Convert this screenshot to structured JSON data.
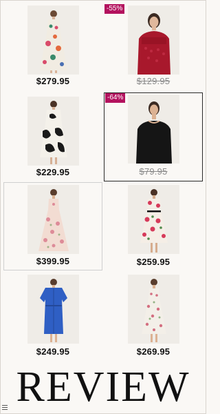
{
  "products": [
    {
      "price": "$279.95",
      "badge": null,
      "price_style": "regular",
      "dress": "floral-maxi-multicolor"
    },
    {
      "price": "$129.95",
      "badge": "-55%",
      "price_style": "strikethrough",
      "dress": "red-lace-top"
    },
    {
      "price": "$229.95",
      "badge": null,
      "price_style": "regular",
      "dress": "black-white-print-midi"
    },
    {
      "price": "$79.95",
      "badge": "-64%",
      "price_style": "strikethrough",
      "dress": "black-top"
    },
    {
      "price": "$399.95",
      "badge": null,
      "price_style": "regular",
      "dress": "pink-floral-maxi"
    },
    {
      "price": "$259.95",
      "badge": null,
      "price_style": "regular",
      "dress": "rose-print-midi"
    },
    {
      "price": "$249.95",
      "badge": null,
      "price_style": "regular",
      "dress": "blue-shirt-dress"
    },
    {
      "price": "$269.95",
      "badge": null,
      "price_style": "regular",
      "dress": "white-floral-sundress"
    }
  ],
  "footer": {
    "title": "REVIEW"
  },
  "colors": {
    "badge": "#b3125e",
    "background": "#faf8f5"
  }
}
